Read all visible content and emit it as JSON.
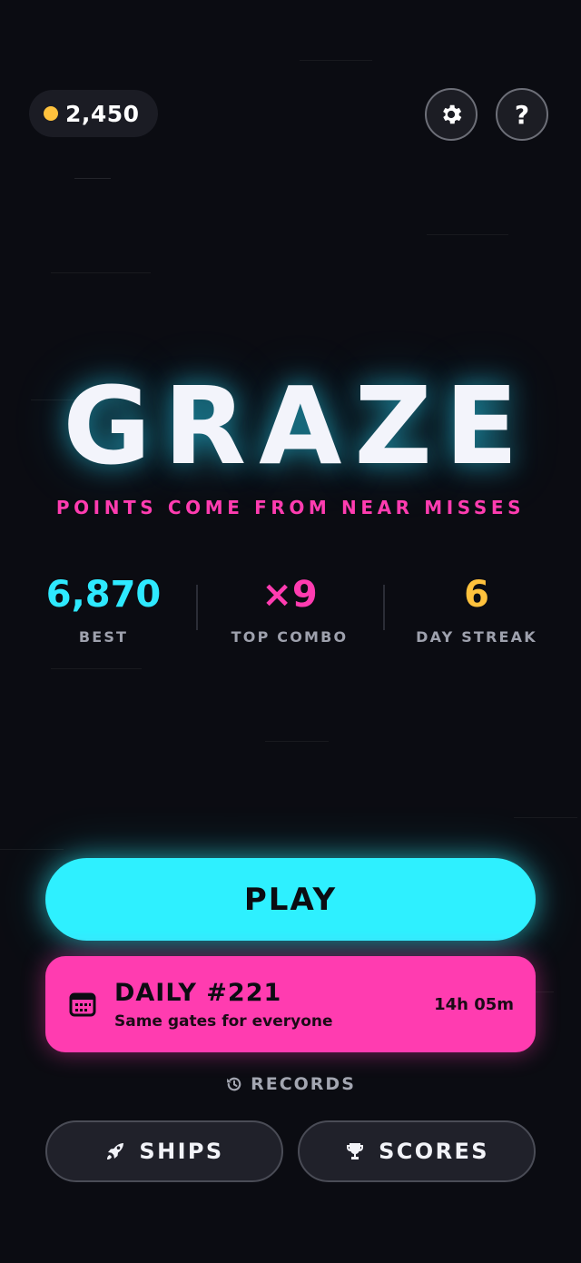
{
  "currency": {
    "coins": "2,450",
    "coin_color": "#ffc23d"
  },
  "top_buttons": {
    "settings_icon": "gear-icon",
    "help_label": "?"
  },
  "title": "GRAZE",
  "tagline": "POINTS COME FROM NEAR MISSES",
  "stats": [
    {
      "value": "6,870",
      "label": "BEST",
      "color": "#2ee9ff"
    },
    {
      "value": "×9",
      "label": "TOP COMBO",
      "color": "#ff3cb0"
    },
    {
      "value": "6",
      "label": "DAY STREAK",
      "color": "#ffc23d"
    }
  ],
  "play": {
    "label": "PLAY",
    "color": "#2ef0ff"
  },
  "daily": {
    "title": "DAILY #221",
    "subtitle": "Same gates for everyone",
    "timer": "14h 05m",
    "color": "#ff3cb0",
    "icon": "calendar-icon"
  },
  "records": {
    "label": "RECORDS",
    "icon": "history-icon"
  },
  "bottom_nav": [
    {
      "label": "SHIPS",
      "icon": "ship-icon"
    },
    {
      "label": "SCORES",
      "icon": "trophy-icon"
    }
  ]
}
